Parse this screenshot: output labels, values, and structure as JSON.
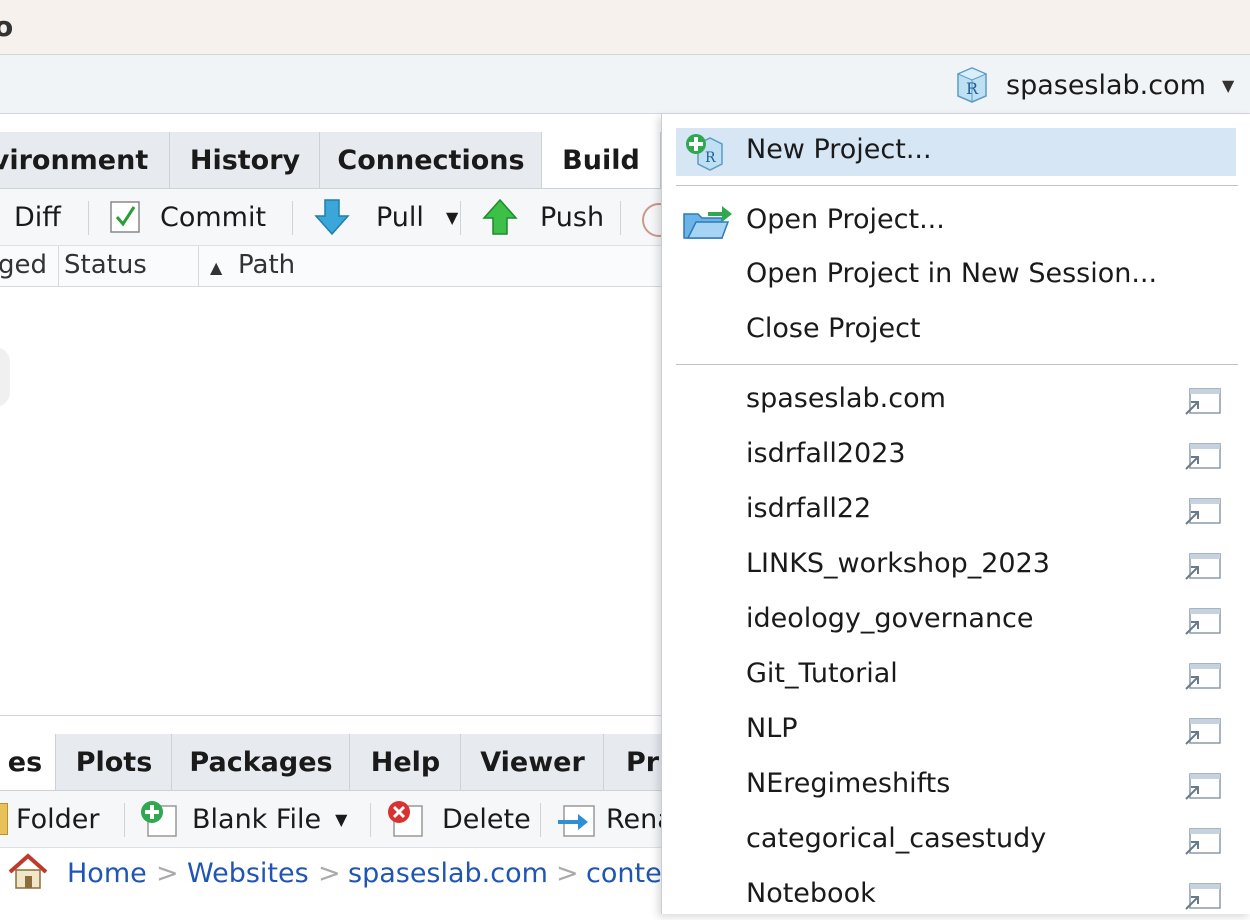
{
  "window": {
    "title_fragment": "o"
  },
  "main_toolbar": {
    "project_label": "spaseslab.com"
  },
  "upper_pane": {
    "tabs": [
      "vironment",
      "History",
      "Connections",
      "Build"
    ],
    "toolbar": {
      "diff": "Diff",
      "commit": "Commit",
      "pull": "Pull",
      "push": "Push"
    },
    "columns": {
      "staged": "ged",
      "status": "Status",
      "path": "Path"
    }
  },
  "lower_pane": {
    "tabs": [
      "es",
      "Plots",
      "Packages",
      "Help",
      "Viewer",
      "Pr"
    ],
    "toolbar": {
      "folder": "Folder",
      "blank_file": "Blank File",
      "delete": "Delete",
      "rename": "Rena"
    },
    "breadcrumb": [
      "Home",
      "Websites",
      "spaseslab.com",
      "conte"
    ]
  },
  "project_menu": {
    "items": [
      "New Project...",
      "Open Project...",
      "Open Project in New Session...",
      "Close Project"
    ],
    "recent_projects": [
      "spaseslab.com",
      "isdrfall2023",
      "isdrfall22",
      "LINKS_workshop_2023",
      "ideology_governance",
      "Git_Tutorial",
      "NLP",
      "NEregimeshifts",
      "categorical_casestudy",
      "Notebook"
    ]
  },
  "colors": {
    "accent_highlight": "#d6e6f5",
    "link": "#2055b3",
    "tab_bg": "#e7ebef"
  }
}
